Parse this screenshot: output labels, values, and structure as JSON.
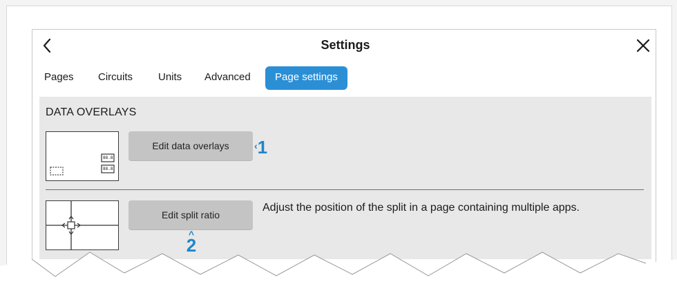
{
  "header": {
    "title": "Settings",
    "back_icon": "chevron-left-icon",
    "close_icon": "close-icon"
  },
  "tabs": [
    {
      "label": "Pages",
      "active": false
    },
    {
      "label": "Circuits",
      "active": false
    },
    {
      "label": "Units",
      "active": false
    },
    {
      "label": "Advanced",
      "active": false
    },
    {
      "label": "Page settings",
      "active": true
    }
  ],
  "data_overlays": {
    "section_title": "DATA OVERLAYS",
    "edit_button_label": "Edit data overlays",
    "thumbnail_icon": "data-overlay-layout-icon",
    "mini_label_1": "88.8",
    "mini_label_2": "88.8"
  },
  "split_ratio": {
    "edit_button_label": "Edit split ratio",
    "description": "Adjust the position of the split in a page containing multiple apps.",
    "thumbnail_icon": "split-ratio-move-icon"
  },
  "callouts": {
    "callout_1": "1",
    "callout_2": "2"
  },
  "colors": {
    "accent": "#2b8fd6",
    "callout": "#1f86c9",
    "content_bg": "#e8e8e8",
    "button_bg": "#c4c4c4"
  }
}
